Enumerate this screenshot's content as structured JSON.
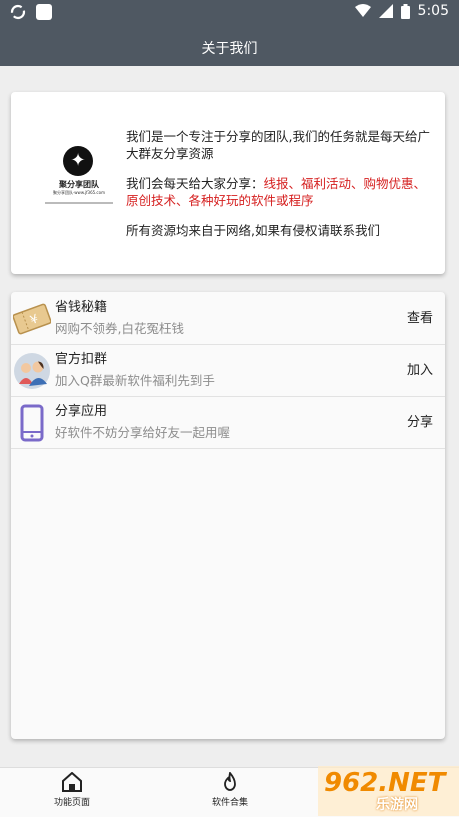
{
  "status_bar": {
    "time": "5:05"
  },
  "app_bar": {
    "title": "关于我们"
  },
  "intro": {
    "logo": {
      "name": "聚分享团队",
      "tagline": "聚分享团队·www.jf365.com"
    },
    "p1": "我们是一个专注于分享的团队,我们的任务就是每天给广大群友分享资源",
    "p2_prefix": "我们会每天给大家分享：",
    "p2_highlight": "线报、福利活动、购物优惠、原创技术、各种好玩的软件或程序",
    "p3": "所有资源均来自于网络,如果有侵权请联系我们"
  },
  "list": [
    {
      "title": "省钱秘籍",
      "subtitle": "网购不领券,白花冤枉钱",
      "action": "查看",
      "icon": "coupon-icon"
    },
    {
      "title": "官方扣群",
      "subtitle": "加入Q群最新软件福利先到手",
      "action": "加入",
      "icon": "group-avatar-icon"
    },
    {
      "title": "分享应用",
      "subtitle": "好软件不妨分享给好友一起用喔",
      "action": "分享",
      "icon": "phone-icon"
    }
  ],
  "bottom_nav": [
    {
      "label": "功能页面",
      "icon": "home-icon"
    },
    {
      "label": "软件合集",
      "icon": "fire-icon"
    }
  ],
  "watermark": {
    "brand": "962.NET",
    "sub": "乐游网"
  },
  "colors": {
    "appbar": "#4f5862",
    "highlight": "#d51f1f",
    "subtitle": "#8d8d8d"
  }
}
